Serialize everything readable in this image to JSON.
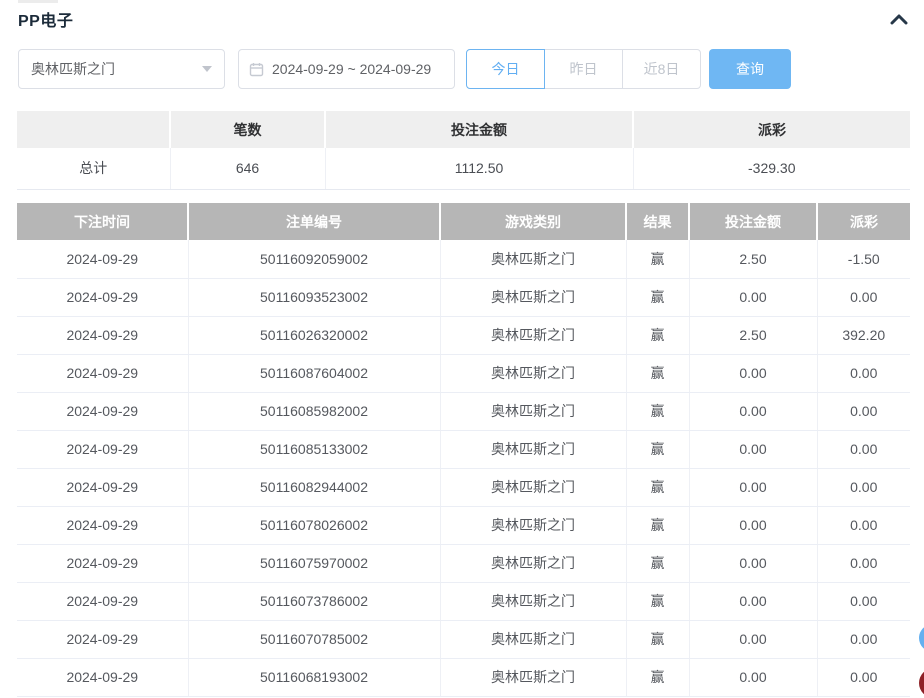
{
  "panel": {
    "title": "PP电子",
    "collapse_icon": "chevron-up"
  },
  "filters": {
    "game_select": {
      "value": "奥林匹斯之门",
      "icon": "caret-down-icon"
    },
    "date_range": {
      "value": "2024-09-29 ~ 2024-09-29",
      "icon": "calendar-icon"
    },
    "quick_buttons": [
      {
        "label": "今日",
        "active": true
      },
      {
        "label": "昨日",
        "active": false
      },
      {
        "label": "近8日",
        "active": false
      }
    ],
    "search_button_label": "查询"
  },
  "summary_table": {
    "headers": [
      "",
      "笔数",
      "投注金额",
      "派彩"
    ],
    "total_row": {
      "label": "总计",
      "count": "646",
      "bet_amount": "1112.50",
      "payout": "-329.30"
    }
  },
  "detail_table": {
    "headers": [
      "下注时间",
      "注单编号",
      "游戏类别",
      "结果",
      "投注金额",
      "派彩"
    ],
    "rows": [
      {
        "date": "2024-09-29",
        "bet_id": "50116092059002",
        "game": "奥林匹斯之门",
        "result": "赢",
        "amount": "2.50",
        "payout": "-1.50"
      },
      {
        "date": "2024-09-29",
        "bet_id": "50116093523002",
        "game": "奥林匹斯之门",
        "result": "赢",
        "amount": "0.00",
        "payout": "0.00"
      },
      {
        "date": "2024-09-29",
        "bet_id": "50116026320002",
        "game": "奥林匹斯之门",
        "result": "赢",
        "amount": "2.50",
        "payout": "392.20"
      },
      {
        "date": "2024-09-29",
        "bet_id": "50116087604002",
        "game": "奥林匹斯之门",
        "result": "赢",
        "amount": "0.00",
        "payout": "0.00"
      },
      {
        "date": "2024-09-29",
        "bet_id": "50116085982002",
        "game": "奥林匹斯之门",
        "result": "赢",
        "amount": "0.00",
        "payout": "0.00"
      },
      {
        "date": "2024-09-29",
        "bet_id": "50116085133002",
        "game": "奥林匹斯之门",
        "result": "赢",
        "amount": "0.00",
        "payout": "0.00"
      },
      {
        "date": "2024-09-29",
        "bet_id": "50116082944002",
        "game": "奥林匹斯之门",
        "result": "赢",
        "amount": "0.00",
        "payout": "0.00"
      },
      {
        "date": "2024-09-29",
        "bet_id": "50116078026002",
        "game": "奥林匹斯之门",
        "result": "赢",
        "amount": "0.00",
        "payout": "0.00"
      },
      {
        "date": "2024-09-29",
        "bet_id": "50116075970002",
        "game": "奥林匹斯之门",
        "result": "赢",
        "amount": "0.00",
        "payout": "0.00"
      },
      {
        "date": "2024-09-29",
        "bet_id": "50116073786002",
        "game": "奥林匹斯之门",
        "result": "赢",
        "amount": "0.00",
        "payout": "0.00"
      },
      {
        "date": "2024-09-29",
        "bet_id": "50116070785002",
        "game": "奥林匹斯之门",
        "result": "赢",
        "amount": "0.00",
        "payout": "0.00"
      },
      {
        "date": "2024-09-29",
        "bet_id": "50116068193002",
        "game": "奥林匹斯之门",
        "result": "赢",
        "amount": "0.00",
        "payout": "0.00"
      }
    ]
  },
  "colors": {
    "accent_blue": "#6fb7f3",
    "active_button_blue": "#62aef2",
    "negative_red": "#f25f6e",
    "detail_header_gray": "#b6b6b6",
    "summary_header_gray": "#efefef"
  }
}
